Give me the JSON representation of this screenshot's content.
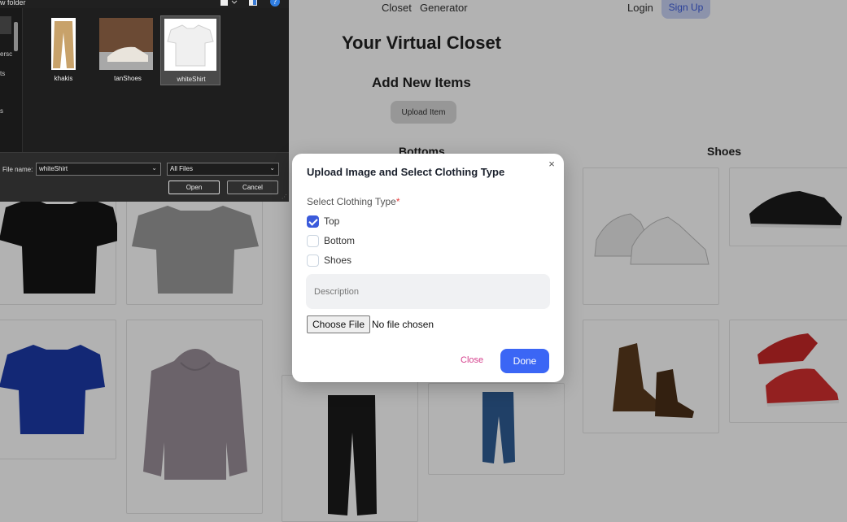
{
  "nav": {
    "closet": "Closet",
    "generator": "Generator",
    "login": "Login",
    "signup": "Sign Up"
  },
  "page": {
    "title": "Your Virtual Closet",
    "add_heading": "Add New Items",
    "upload_label": "Upload Item",
    "sections": {
      "bottoms": "Bottoms",
      "shoes": "Shoes"
    }
  },
  "file_dialog": {
    "new_folder": "w folder",
    "nav_items": [
      "ersc",
      "ts",
      "",
      "s"
    ],
    "files": [
      {
        "name": "khakis",
        "selected": false
      },
      {
        "name": "tanShoes",
        "selected": false
      },
      {
        "name": "whiteShirt",
        "selected": true
      }
    ],
    "file_name_label": "File name:",
    "file_name_value": "whiteShirt",
    "file_type": "All Files",
    "open_label": "Open",
    "cancel_label": "Cancel"
  },
  "modal": {
    "title": "Upload Image and Select Clothing Type",
    "close_glyph": "×",
    "field_label": "Select Clothing Type",
    "required_mark": "*",
    "options": [
      {
        "label": "Top",
        "checked": true
      },
      {
        "label": "Bottom",
        "checked": false
      },
      {
        "label": "Shoes",
        "checked": false
      }
    ],
    "description_placeholder": "Description",
    "choose_file_label": "Choose File",
    "no_file_text": "No file chosen",
    "close_label": "Close",
    "done_label": "Done"
  },
  "colors": {
    "accent": "#3b66f5",
    "close_link": "#d53f8c",
    "required": "#e53e3e"
  }
}
